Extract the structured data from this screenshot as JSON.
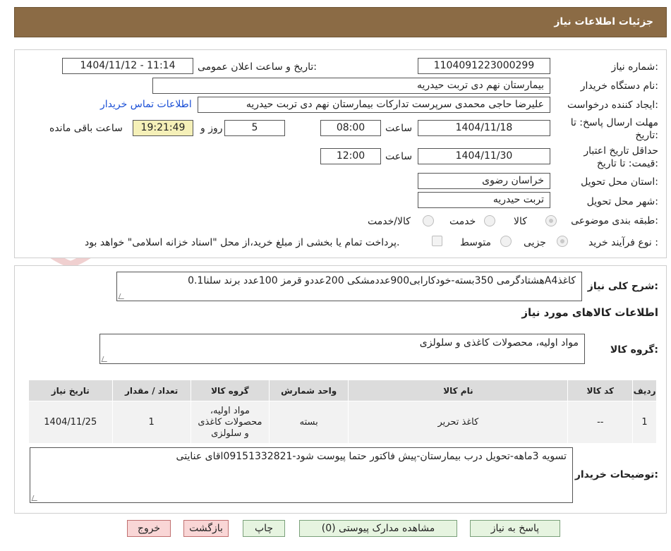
{
  "header": {
    "title": "جزئیات اطلاعات نیاز"
  },
  "watermark": {
    "text": "AriaTender.neT"
  },
  "form": {
    "need_number_label": "شماره نیاز:",
    "need_number": "1104091223000299",
    "announce_label": "تاریخ و ساعت اعلان عمومی:",
    "announce_value": "1404/11/12 - 11:14",
    "buyer_org_label": "نام دستگاه خریدار:",
    "buyer_org": "بیمارستان نهم دی تربت حیدریه",
    "requester_label": "ایجاد کننده درخواست:",
    "requester": "علیرضا حاجی محمدی سرپرست تدارکات بیمارستان نهم دی تربت حیدریه",
    "contact_link": "اطلاعات تماس خریدار",
    "deadline_label_1": "مهلت ارسال پاسخ: تا",
    "deadline_label_2": "تاریخ:",
    "deadline_date": "1404/11/18",
    "time_label": "ساعت",
    "deadline_time": "08:00",
    "days_value": "5",
    "days_label": "روز و",
    "remaining_time": "19:21:49",
    "remaining_label": "ساعت باقی مانده",
    "validity_label_1": "حداقل تاریخ اعتبار",
    "validity_label_2": "قیمت: تا تاریخ:",
    "validity_date": "1404/11/30",
    "validity_time": "12:00",
    "province_label": "استان محل تحویل:",
    "province": "خراسان رضوی",
    "city_label": "شهر محل تحویل:",
    "city": "تربت حیدریه",
    "category_label": "طبقه بندی موضوعی:",
    "category_options": [
      "کالا",
      "خدمت",
      "کالا/خدمت"
    ],
    "category_selected": "کالا",
    "process_label": "نوع فرآیند خرید :",
    "process_options": [
      "جزیی",
      "متوسط"
    ],
    "process_selected": "جزیی",
    "payment_note": "پرداخت تمام یا بخشی از مبلغ خرید،از محل \"اسناد خزانه اسلامی\" خواهد بود."
  },
  "summary": {
    "label": "شرح کلی نیاز:",
    "value": "کاغذA4هشتادگرمی 350بسته-خودکارابی900عددمشکی 200عددو قرمز 100عدد برند سلنا0.1"
  },
  "goods": {
    "section_title": "اطلاعات کالاهای مورد نیاز",
    "group_label": "گروه کالا:",
    "group_value": "مواد اولیه، محصولات کاغذی و سلولزی",
    "columns": [
      "ردیف",
      "کد کالا",
      "نام کالا",
      "واحد شمارش",
      "گروه کالا",
      "تعداد / مقدار",
      "تاریخ نیاز"
    ],
    "rows": [
      [
        "1",
        "--",
        "کاغذ تحریر",
        "بسته",
        "مواد اولیه، محصولات کاغذی و سلولزی",
        "1",
        "1404/11/25"
      ]
    ]
  },
  "buyer_notes": {
    "label": "توضیحات خریدار:",
    "value": "تسویه 3ماهه-تحویل درب بیمارستان-پیش فاکتور حتما پیوست شود-09151332821اقای عنایتی"
  },
  "buttons": {
    "reply": "پاسخ به نیاز",
    "attachments": "مشاهده مدارک پیوستی (0)",
    "print": "چاپ",
    "back": "بازگشت",
    "exit": "خروج"
  },
  "colors": {
    "header_bg": "#8b6b45",
    "link": "#1a4fd6",
    "highlight": "#f5f0b8"
  }
}
